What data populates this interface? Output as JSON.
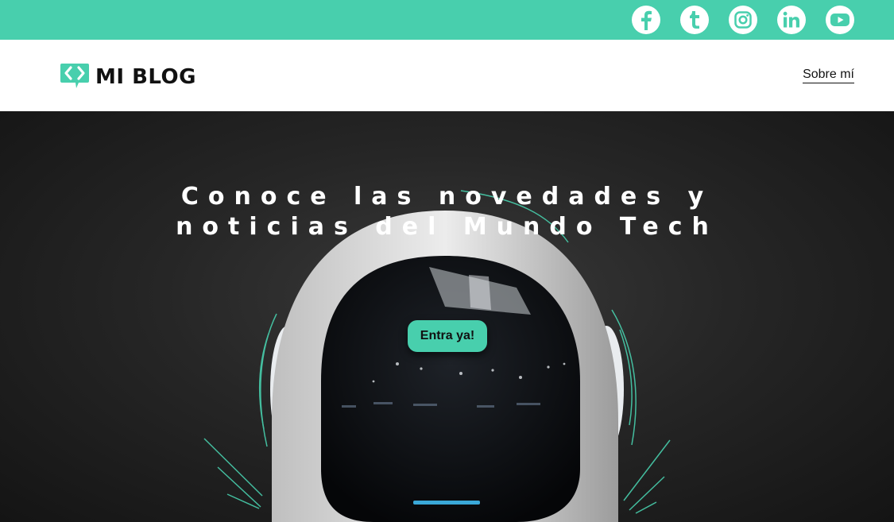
{
  "colors": {
    "accent": "#48cfad",
    "header_bg": "#ffffff",
    "hero_bg": "#1e1e1e"
  },
  "social": [
    {
      "name": "facebook",
      "icon": "facebook-icon"
    },
    {
      "name": "tumblr",
      "icon": "tumblr-icon"
    },
    {
      "name": "instagram",
      "icon": "instagram-icon"
    },
    {
      "name": "linkedin",
      "icon": "linkedin-icon"
    },
    {
      "name": "youtube",
      "icon": "youtube-icon"
    }
  ],
  "header": {
    "logo_text": "MI BLOG",
    "logo_icon": "code-chat-icon",
    "nav_link": "Sobre mí"
  },
  "hero": {
    "title": "Conoce las novedades y\nnoticias del Mundo Tech",
    "cta_label": "Entra ya!"
  }
}
